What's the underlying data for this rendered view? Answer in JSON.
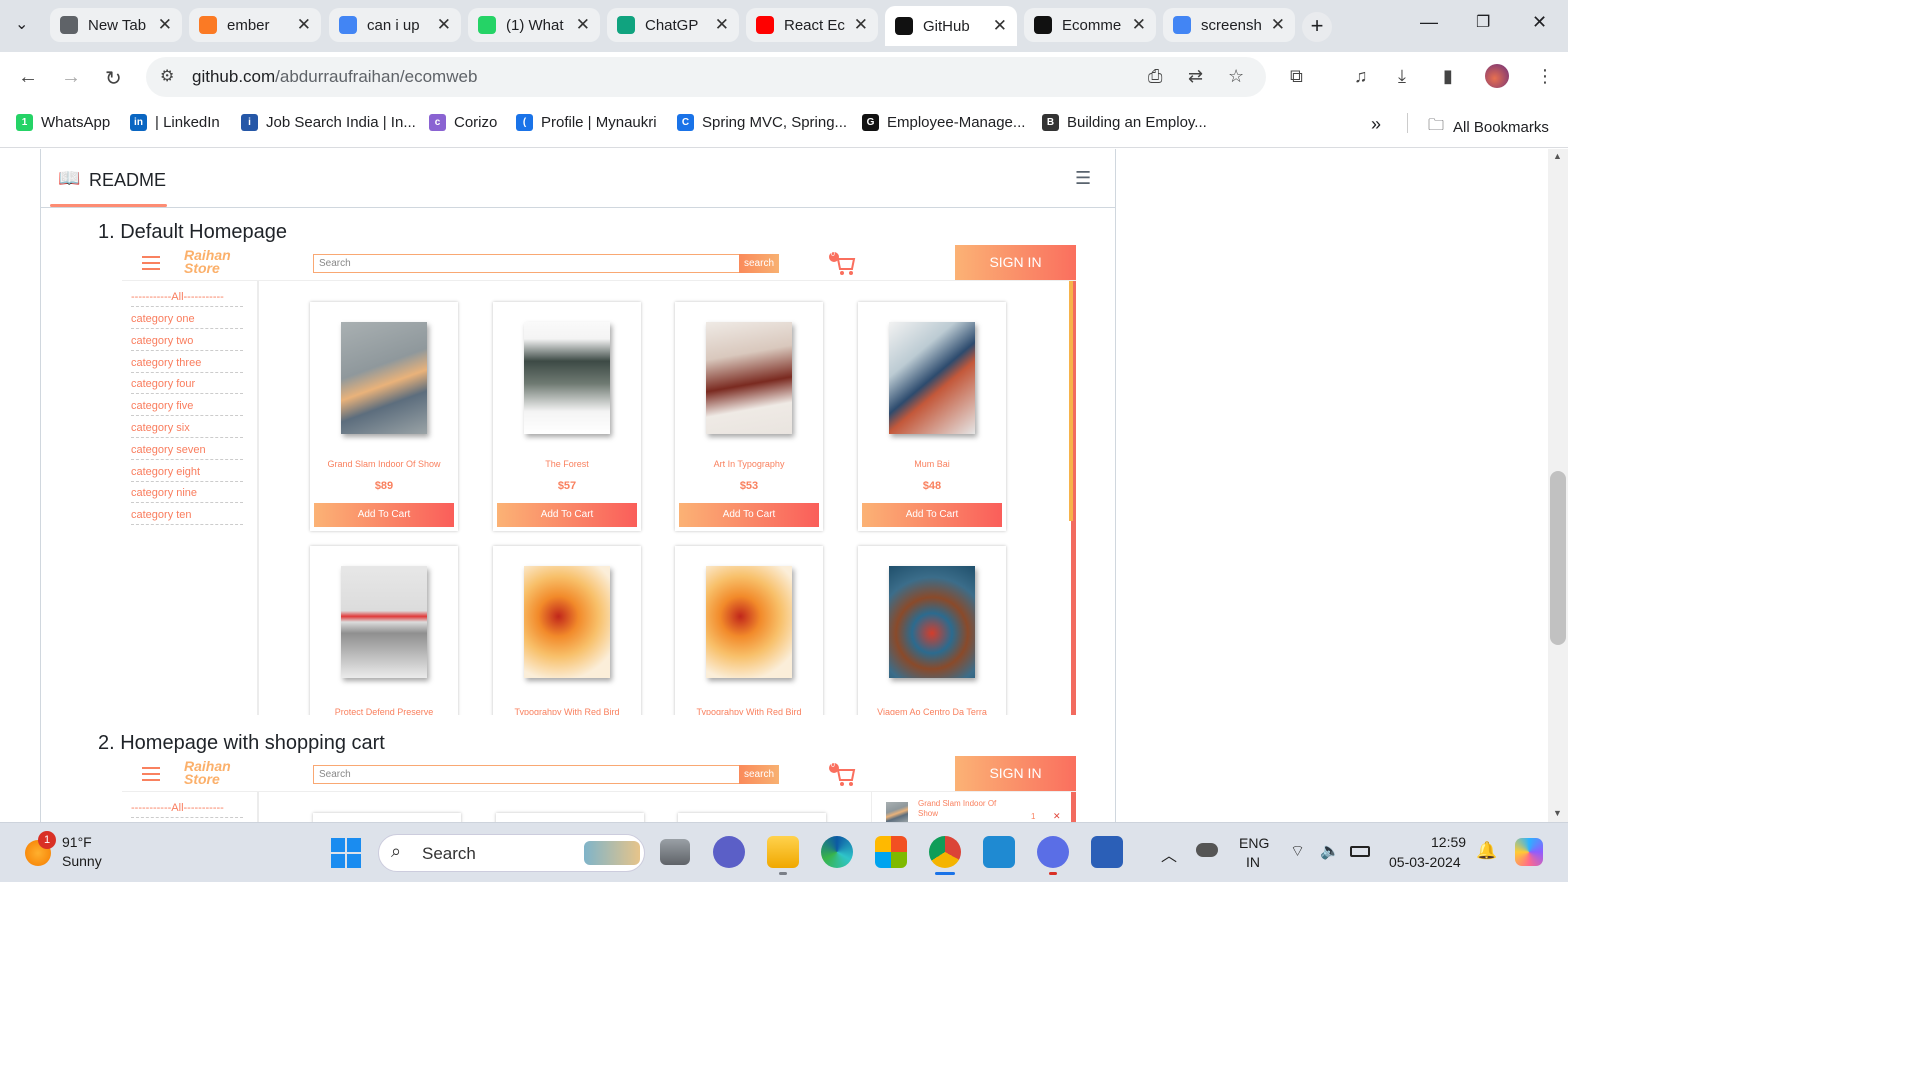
{
  "browser": {
    "tabs": [
      {
        "title": "New Tab",
        "icon": "chrome-icon",
        "color": "#5f6368"
      },
      {
        "title": "ember",
        "icon": "xampp-icon",
        "color": "#fb7a24"
      },
      {
        "title": "can i up",
        "icon": "google-icon",
        "color": "#4285f4"
      },
      {
        "title": "(1) What",
        "icon": "whatsapp-icon",
        "color": "#25d366"
      },
      {
        "title": "ChatGP",
        "icon": "chatgpt-icon",
        "color": "#10a37f"
      },
      {
        "title": "React Ec",
        "icon": "youtube-icon",
        "color": "#ff0000"
      },
      {
        "title": "GitHub",
        "icon": "github-icon",
        "color": "#111111"
      },
      {
        "title": "Ecomme",
        "icon": "ecom-icon",
        "color": "#111111"
      },
      {
        "title": "screensh",
        "icon": "google-icon",
        "color": "#4285f4"
      }
    ],
    "active_tab": 6,
    "url_host": "github.com",
    "url_path": "/abdurraufraihan/ecomweb",
    "bookmarks": [
      {
        "label": "WhatsApp",
        "color": "#25d366",
        "glyph": "1"
      },
      {
        "label": "| LinkedIn",
        "color": "#0a66c2",
        "glyph": "in"
      },
      {
        "label": "Job Search India | In...",
        "color": "#2557a7",
        "glyph": "i"
      },
      {
        "label": "Corizo",
        "color": "#8a63d2",
        "glyph": "c"
      },
      {
        "label": "Profile | Mynaukri",
        "color": "#1a73e8",
        "glyph": "("
      },
      {
        "label": "Spring MVC, Spring...",
        "color": "#1a73e8",
        "glyph": "C"
      },
      {
        "label": "Employee-Manage...",
        "color": "#111111",
        "glyph": "G"
      },
      {
        "label": "Building an Employ...",
        "color": "#333333",
        "glyph": "B"
      }
    ],
    "all_bookmarks": "All Bookmarks",
    "more": "»"
  },
  "readme": {
    "title": "README",
    "heading1": "1. Default Homepage",
    "heading2": "2. Homepage with shopping cart"
  },
  "store": {
    "logo_line1": "Raihan",
    "logo_line2": "Store",
    "search_placeholder": "Search",
    "search_btn": "search",
    "signin": "SIGN IN",
    "cart_count": "0",
    "all_label": "-----------All-----------",
    "categories": [
      "category one",
      "category two",
      "category three",
      "category four",
      "category five",
      "category six",
      "category seven",
      "category eight",
      "category nine",
      "category ten"
    ],
    "products": [
      {
        "name": "Grand Slam Indoor Of Show",
        "price": "$89"
      },
      {
        "name": "The Forest",
        "price": "$57"
      },
      {
        "name": "Art In Typography",
        "price": "$53"
      },
      {
        "name": "Mum Bai",
        "price": "$48"
      },
      {
        "name": "Protect Defend Preserve",
        "price": ""
      },
      {
        "name": "Typograhpy With Red Bird",
        "price": ""
      },
      {
        "name": "Typograhpy With Red Bird",
        "price": ""
      },
      {
        "name": "Viagem Ao Centro Da Terra",
        "price": ""
      }
    ],
    "add_to_cart": "Add To Cart",
    "cart_item_name": "Grand Slam Indoor Of Show",
    "cart_item_qty": "1"
  },
  "taskbar": {
    "weather_temp": "91°F",
    "weather_desc": "Sunny",
    "weather_badge": "1",
    "search": "Search",
    "lang1": "ENG",
    "lang2": "IN",
    "time": "12:59",
    "date": "05-03-2024"
  }
}
